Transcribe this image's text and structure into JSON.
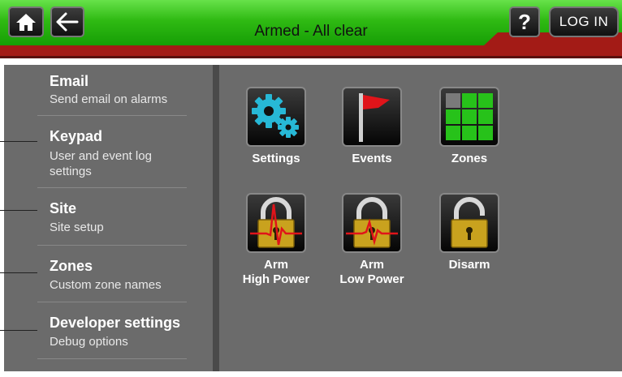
{
  "header": {
    "title": "Armed - All clear",
    "help_label": "?",
    "login_label": "LOG IN"
  },
  "sidebar": {
    "items": [
      {
        "title": "Email",
        "subtitle": "Send email on alarms"
      },
      {
        "title": "Keypad",
        "subtitle": "User and event log settings"
      },
      {
        "title": "Site",
        "subtitle": "Site setup"
      },
      {
        "title": "Zones",
        "subtitle": "Custom zone names"
      },
      {
        "title": "Developer settings",
        "subtitle": "Debug options"
      }
    ]
  },
  "tiles": [
    {
      "label": "Settings",
      "icon": "gears-icon"
    },
    {
      "label": "Events",
      "icon": "flag-icon"
    },
    {
      "label": "Zones",
      "icon": "grid-icon"
    },
    {
      "label_line1": "Arm",
      "label_line2": "High Power",
      "icon": "padlock-high-wave-icon"
    },
    {
      "label_line1": "Arm",
      "label_line2": "Low Power",
      "icon": "padlock-low-wave-icon"
    },
    {
      "label": "Disarm",
      "icon": "padlock-open-icon"
    }
  ],
  "colors": {
    "header_green": "#2fba13",
    "header_red": "#a31b16",
    "panel_gray": "#6b6b6b",
    "zone_green": "#27c21a",
    "flag_red": "#e0141a",
    "lock_gold": "#c9a21e",
    "gear_cyan": "#27b8d6"
  }
}
